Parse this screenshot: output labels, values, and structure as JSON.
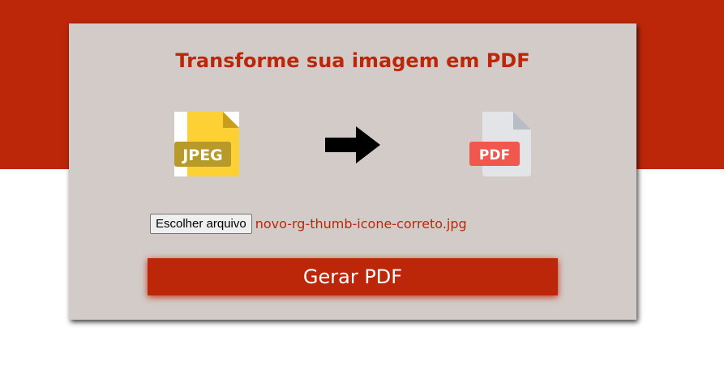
{
  "page": {
    "heading": "Transforme sua imagem em PDF"
  },
  "icons": {
    "source": {
      "name": "jpeg-file-icon",
      "label": "JPEG"
    },
    "arrow": {
      "name": "arrow-right-icon"
    },
    "target": {
      "name": "pdf-file-icon",
      "label": "PDF"
    }
  },
  "upload": {
    "button_label": "Escolher arquivo",
    "file_name": "novo-rg-thumb-icone-correto.jpg"
  },
  "action": {
    "generate_label": "Gerar PDF"
  },
  "colors": {
    "accent": "#bd2709",
    "card": "#d3cbc8",
    "jpeg_yellow": "#fdd033",
    "pdf_red": "#f1574d"
  }
}
